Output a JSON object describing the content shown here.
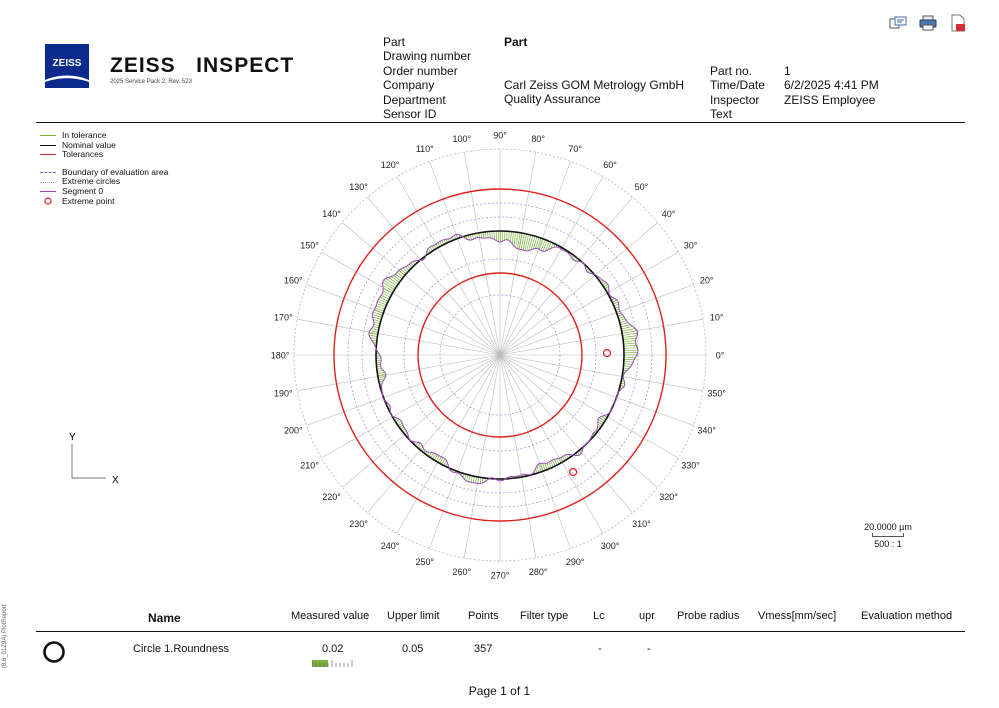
{
  "toolbar": {
    "icons": [
      "comment-icon",
      "print-icon",
      "pdf-icon"
    ]
  },
  "logo": {
    "text": "ZEISS",
    "color": "#0a2a8c"
  },
  "brand": {
    "title": "ZEISS   INSPECT",
    "subtitle": "2025 Service Pack 2, Rev. 523"
  },
  "header": {
    "labels1": [
      "Part",
      "Drawing number",
      "Order number",
      "Company",
      "Department",
      "Sensor ID"
    ],
    "values1": [
      "Part",
      "",
      "",
      "Carl Zeiss GOM Metrology GmbH",
      "Quality Assurance",
      ""
    ],
    "labels2": [
      "Part no.",
      "Time/Date",
      "Inspector",
      "Text"
    ],
    "values2": [
      "1",
      "6/2/2025 4:41 PM",
      "ZEISS Employee",
      ""
    ]
  },
  "legend": {
    "items": [
      {
        "label": "In tolerance",
        "color": "#7ab33c",
        "style": "solid"
      },
      {
        "label": "Nominal value",
        "color": "#111111",
        "style": "solid"
      },
      {
        "label": "Tolerances",
        "color": "#e0201b",
        "style": "solid"
      },
      {
        "label": "Boundary of evaluation area",
        "color": "#7070c0",
        "style": "dashed"
      },
      {
        "label": "Extreme circles",
        "color": "#9aa8d8",
        "style": "dotted"
      },
      {
        "label": "Segment 0",
        "color": "#9b4db5",
        "style": "solid"
      },
      {
        "label": "Extreme point",
        "color": "#e0201b",
        "style": "circle"
      }
    ]
  },
  "axes": {
    "y": "Y",
    "x": "X"
  },
  "polar": {
    "angle_labels": [
      "0°",
      "10°",
      "20°",
      "30°",
      "40°",
      "50°",
      "60°",
      "70°",
      "80°",
      "90°",
      "100°",
      "110°",
      "120°",
      "130°",
      "140°",
      "150°",
      "160°",
      "170°",
      "180°",
      "190°",
      "200°",
      "210°",
      "220°",
      "230°",
      "240°",
      "250°",
      "260°",
      "270°",
      "280°",
      "290°",
      "300°",
      "310°",
      "320°",
      "330°",
      "340°",
      "350°"
    ],
    "nominal_color": "#111111",
    "tolerance_color": "#e0201b",
    "measured_color": "#9b4db5",
    "fill_color": "#7ab33c",
    "extreme_points_deg": [
      1,
      302
    ]
  },
  "scale": {
    "value": "20.0000 µm",
    "ratio": "500 : 1"
  },
  "table": {
    "headers": [
      "Name",
      "Measured value",
      "Upper limit",
      "Points",
      "Filter type",
      "Lc",
      "upr",
      "Probe radius",
      "Vmess[mm/sec]",
      "Evaluation method"
    ],
    "row": {
      "name": "Circle 1.Roundness",
      "measured": "0.02",
      "upper": "0.05",
      "points": "357",
      "lc": "-",
      "upr": "-",
      "measured_fill": 0.4
    }
  },
  "footer": {
    "page": "Page 1 of 1"
  },
  "side_text": "(8.6_01Z9A) PlotReport"
}
